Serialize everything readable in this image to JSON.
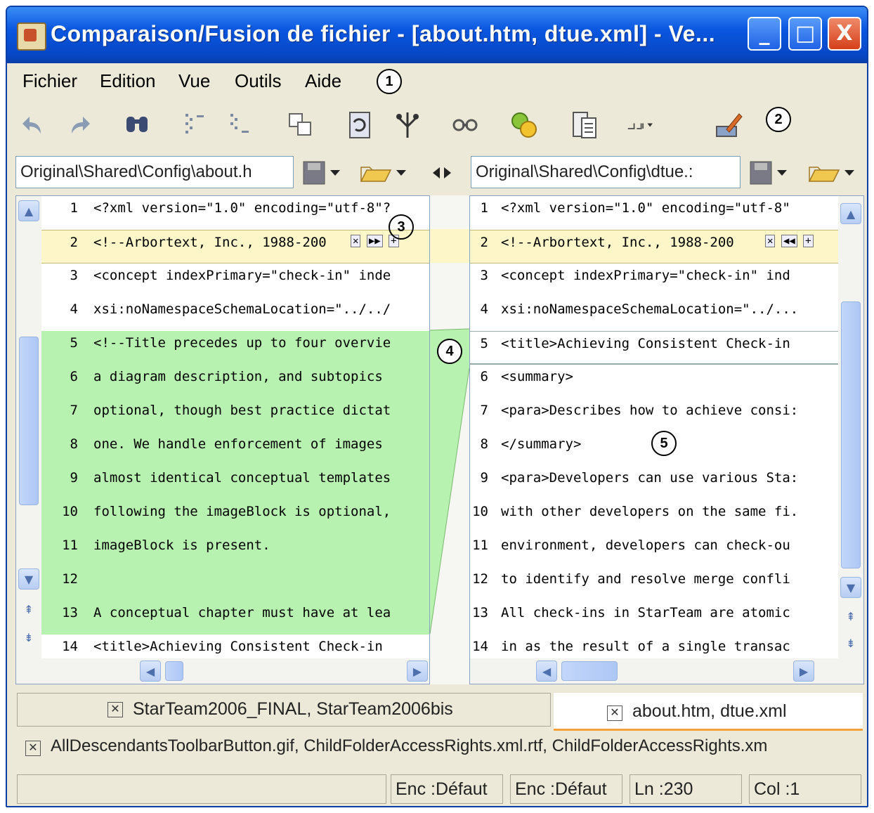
{
  "window": {
    "title": "Comparaison/Fusion de fichier - [about.htm, dtue.xml] - Ve...",
    "buttons": {
      "minimize": "_",
      "maximize": "□",
      "close": "X"
    }
  },
  "menu": {
    "items": [
      {
        "label": "Fichier"
      },
      {
        "label": "Edition"
      },
      {
        "label": "Vue"
      },
      {
        "label": "Outils"
      },
      {
        "label": "Aide"
      }
    ]
  },
  "callouts": {
    "c1": "1",
    "c2": "2",
    "c3": "3",
    "c4a": "4",
    "c4b": "4",
    "c5": "5"
  },
  "toolbar": {
    "icons": [
      "undo-icon",
      "redo-icon",
      "find-icon",
      "prev-diff-icon",
      "next-diff-icon",
      "copy-icon",
      "refresh-icon",
      "merge-icon",
      "link-icon",
      "options-icon",
      "file-icon",
      "layout-icon",
      "edit-icon"
    ]
  },
  "left": {
    "path": "Original\\Shared\\Config\\about.h",
    "lines": [
      {
        "n": "1",
        "text": "<?xml version=\"1.0\" encoding=\"utf-8\"?",
        "state": "normal"
      },
      {
        "n": "2",
        "text": "<!--Arbortext, Inc., 1988-200",
        "state": "mod"
      },
      {
        "n": "3",
        "text": "<concept indexPrimary=\"check-in\" inde",
        "state": "normal"
      },
      {
        "n": "4",
        "text": "xsi:noNamespaceSchemaLocation=\"../../",
        "state": "normal"
      },
      {
        "n": "5",
        "text": "<!--Title precedes up to four overvie",
        "state": "add"
      },
      {
        "n": "6",
        "text": "a diagram description, and subtopics",
        "state": "add"
      },
      {
        "n": "7",
        "text": "optional, though best practice dictat",
        "state": "add"
      },
      {
        "n": "8",
        "text": "one. We handle enforcement of images",
        "state": "add"
      },
      {
        "n": "9",
        "text": "almost identical conceptual templates",
        "state": "add"
      },
      {
        "n": "10",
        "text": "following the imageBlock is optional,",
        "state": "add"
      },
      {
        "n": "11",
        "text": "imageBlock is present.",
        "state": "add"
      },
      {
        "n": "12",
        "text": "",
        "state": "add"
      },
      {
        "n": "13",
        "text": "A conceptual chapter must have at lea",
        "state": "add"
      },
      {
        "n": "14",
        "text": "<title>Achieving Consistent Check-in",
        "state": "normal"
      }
    ]
  },
  "right": {
    "path": "Original\\Shared\\Config\\dtue.:",
    "lines": [
      {
        "n": "1",
        "text": "<?xml version=\"1.0\" encoding=\"utf-8\"",
        "state": "normal"
      },
      {
        "n": "2",
        "text": "<!--Arbortext, Inc., 1988-200",
        "state": "mod"
      },
      {
        "n": "3",
        "text": "<concept indexPrimary=\"check-in\" ind",
        "state": "normal"
      },
      {
        "n": "4",
        "text": "xsi:noNamespaceSchemaLocation=\"../...",
        "state": "normal"
      },
      {
        "n": "5",
        "text": "<title>Achieving Consistent Check-in",
        "state": "gap"
      },
      {
        "n": "6",
        "text": "<summary>",
        "state": "normal"
      },
      {
        "n": "7",
        "text": "<para>Describes how to achieve consi:",
        "state": "normal"
      },
      {
        "n": "8",
        "text": "</summary>",
        "state": "normal"
      },
      {
        "n": "9",
        "text": "<para>Developers can use various Sta:",
        "state": "normal"
      },
      {
        "n": "10",
        "text": "with other developers on the same fi.",
        "state": "normal"
      },
      {
        "n": "11",
        "text": "environment, developers can check-ou",
        "state": "normal"
      },
      {
        "n": "12",
        "text": "to identify and resolve merge confli",
        "state": "normal"
      },
      {
        "n": "13",
        "text": "All check-ins in StarTeam are atomic",
        "state": "normal"
      },
      {
        "n": "14",
        "text": "in as the result of a single transac",
        "state": "normal"
      }
    ]
  },
  "tabs": [
    {
      "label": "StarTeam2006_FINAL, StarTeam2006bis"
    },
    {
      "label": "about.htm, dtue.xml",
      "active": true
    },
    {
      "label": "AllDescendantsToolbarButton.gif, ChildFolderAccessRights.xml.rtf, ChildFolderAccessRights.xm"
    }
  ],
  "status": {
    "enc_left": "Enc :Défaut",
    "enc_right": "Enc :Défaut",
    "line": "Ln :230",
    "col": "Col :1"
  }
}
